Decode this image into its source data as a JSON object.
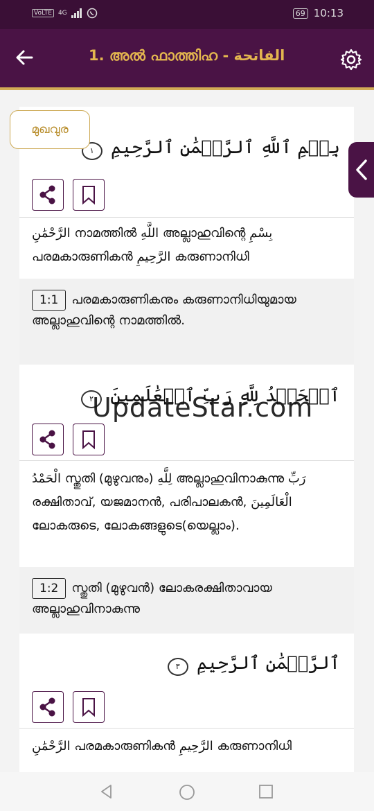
{
  "status": {
    "network": "4G",
    "volte": "VoLTE",
    "battery": "69",
    "time": "10:13"
  },
  "header": {
    "title": "1.  അൽ ഫാത്തിഹ - الفاتحة"
  },
  "intro_button": "മുഖവുര",
  "verses": [
    {
      "arabic": "بِسۡمِ ٱللَّهِ ٱلرَّحۡمَٰنِ ٱلرَّحِيمِ",
      "marker": "١",
      "translation": "الرَّحْمَٰنِ നാമത്തിൽ اللَّهِ അല്ലാഹുവിന്റെ بِسْمِ പരമകാരുണികൻ الرَّحِيمِ കരുണാനിധി",
      "ref": "1:1",
      "meaning": "പരമകാരുണികനും കരുണാനിധിയുമായ അല്ലാഹുവിന്റെ നാമത്തിൽ."
    },
    {
      "arabic": "ٱلۡحَمۡدُ لِلَّهِ رَبِّ ٱلۡعَٰلَمِينَ",
      "marker": "٢",
      "translation": "الْحَمْدُ സ്തുതി (മുഴുവനും) لِلَّهِ അല്ലാഹുവിനാകുന്നു رَبِّ രക്ഷിതാവ്, യജമാനൻ, പരിപാലകൻ, الْعَالَمِينَ ലോകരുടെ, ലോകങ്ങളുടെ(യെല്ലാം).",
      "ref": "1:2",
      "meaning": "സ്തുതി (മുഴുവൻ) ലോകരക്ഷിതാവായ അല്ലാഹുവിനാകുന്നു"
    },
    {
      "arabic": "ٱلرَّحۡمَٰنِ ٱلرَّحِيمِ",
      "marker": "٣",
      "translation": "الرَّحْمَٰنِ പരമകാരുണികൻ الرَّحِيمِ കരുണാനിധി"
    }
  ],
  "watermark": "UpdateStar.com"
}
